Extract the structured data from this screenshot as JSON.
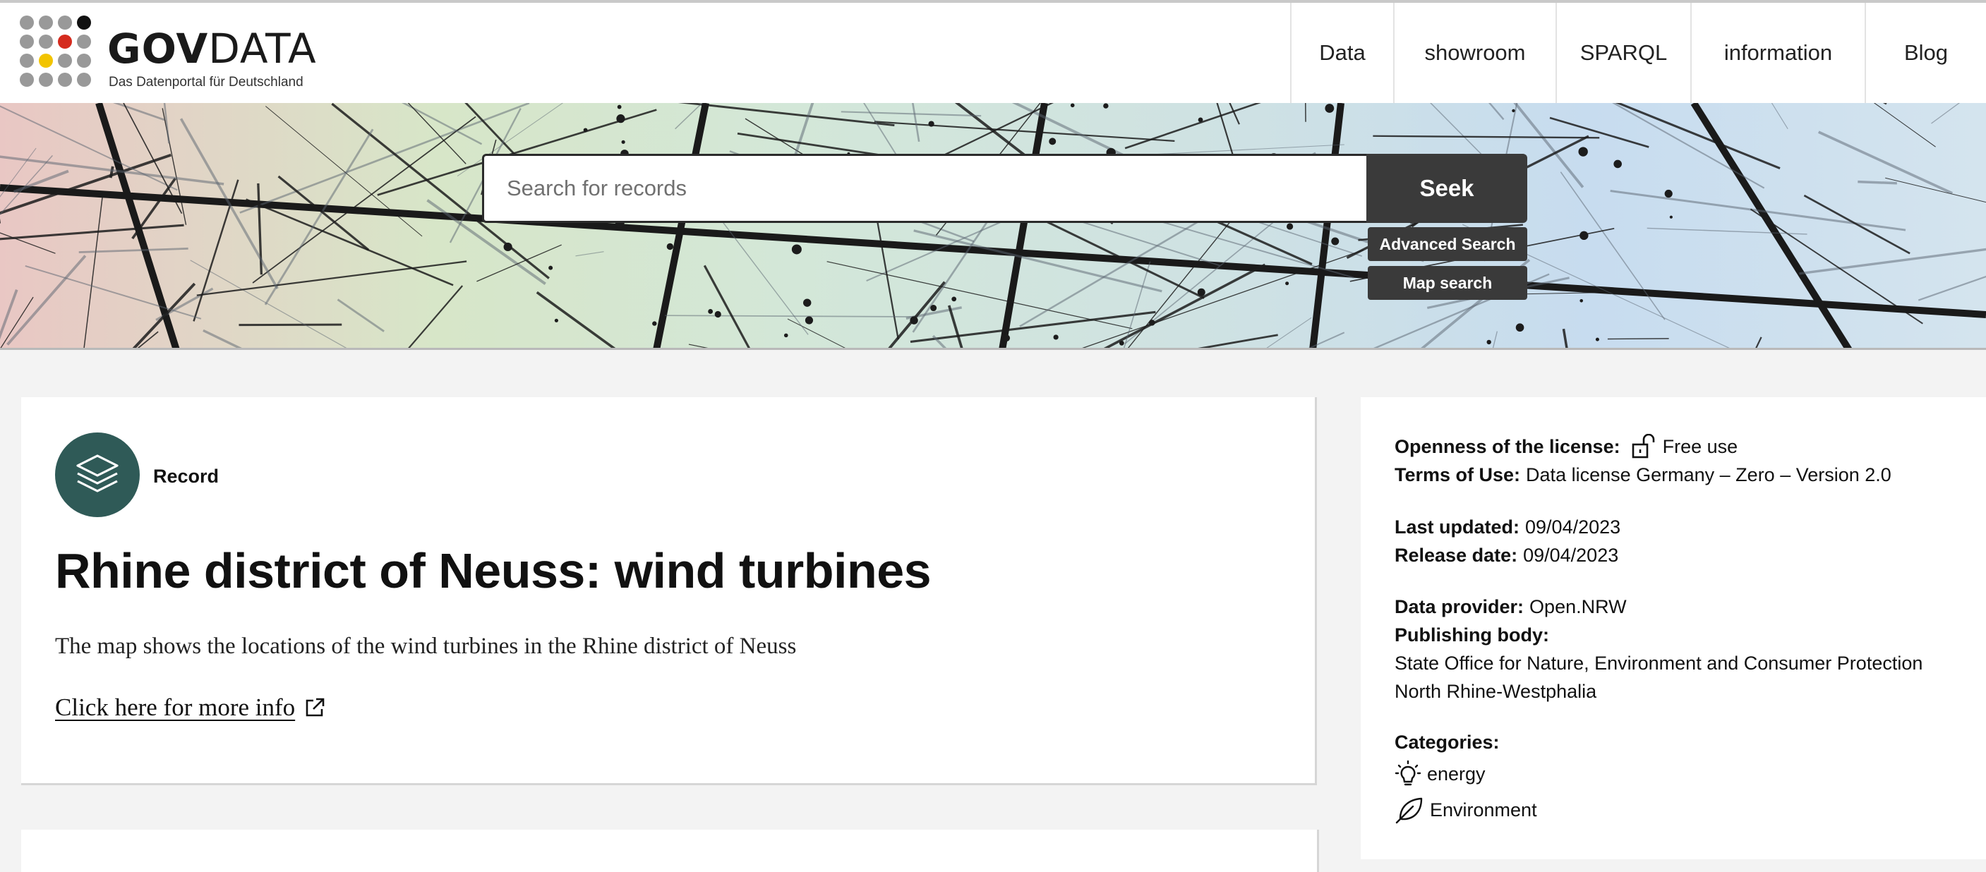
{
  "header": {
    "logo": {
      "brand_bold": "GOV",
      "brand_light": "DATA",
      "tagline": "Das Datenportal für Deutschland"
    },
    "nav": [
      {
        "label": "Data"
      },
      {
        "label": "showroom"
      },
      {
        "label": "SPARQL"
      },
      {
        "label": "information"
      },
      {
        "label": "Blog"
      }
    ]
  },
  "search": {
    "placeholder": "Search for records",
    "submit_label": "Seek",
    "advanced_label": "Advanced Search",
    "map_label": "Map search"
  },
  "record": {
    "type_label": "Record",
    "title": "Rhine district of Neuss: wind turbines",
    "description": "The map shows the locations of the wind turbines in the Rhine district of Neuss",
    "more_info_label": "Click here for more info"
  },
  "sidebar": {
    "license_openness_label": "Openness of the license:",
    "license_openness_value": "Free use",
    "terms_label": "Terms of Use:",
    "terms_value": "Data license Germany – Zero – Version 2.0",
    "last_updated_label": "Last updated:",
    "last_updated_value": "09/04/2023",
    "release_date_label": "Release date:",
    "release_date_value": "09/04/2023",
    "data_provider_label": "Data provider:",
    "data_provider_value": "Open.NRW",
    "publishing_body_label": "Publishing body:",
    "publishing_body_line1": "State Office for Nature, Environment and Consumer Protection",
    "publishing_body_line2": "North Rhine-Westphalia",
    "categories_label": "Categories:",
    "categories": [
      {
        "label": "energy",
        "icon": "lightbulb-icon"
      },
      {
        "label": "Environment",
        "icon": "leaf-icon"
      }
    ]
  },
  "colors": {
    "record_icon_bg": "#2f5a57",
    "button_bg": "#3a3a3a",
    "logo_red": "#d52b1e",
    "logo_yellow": "#f2c400",
    "logo_black": "#111111"
  }
}
